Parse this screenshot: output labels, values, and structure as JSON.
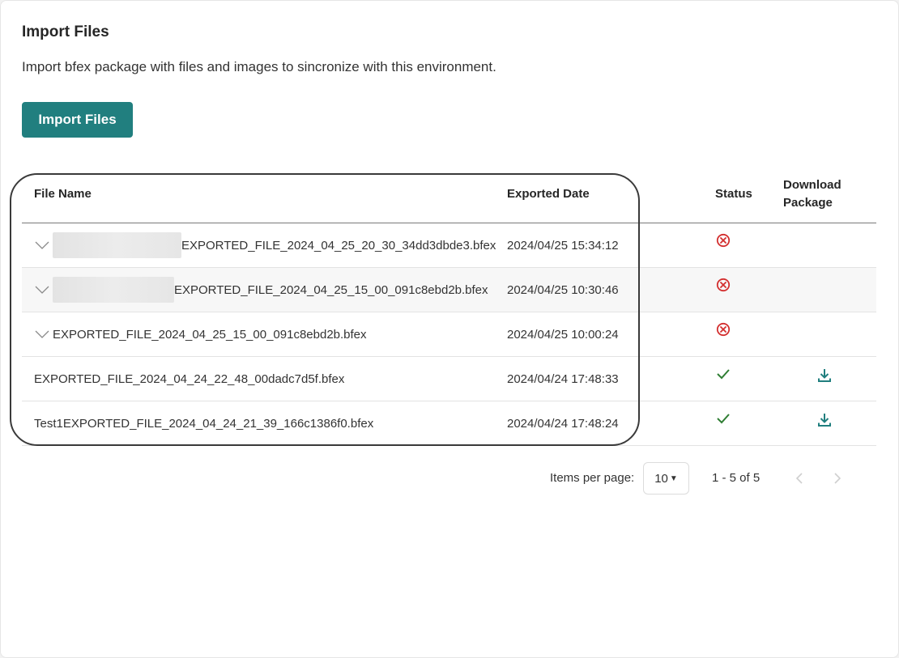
{
  "header": {
    "title": "Import Files",
    "description": "Import bfex package with files and images to sincronize with this environment.",
    "import_button": "Import Files"
  },
  "table": {
    "columns": {
      "file_name": "File Name",
      "exported_date": "Exported Date",
      "status": "Status",
      "download_line1": "Download",
      "download_line2": "Package"
    },
    "rows": [
      {
        "file_name": "EXPORTED_FILE_2024_04_25_20_30_34dd3dbde3.bfex",
        "exported_date": "2024/04/25 15:34:12",
        "status": "error",
        "expandable": true,
        "redacted_prefix": true,
        "downloadable": false
      },
      {
        "file_name": "EXPORTED_FILE_2024_04_25_15_00_091c8ebd2b.bfex",
        "exported_date": "2024/04/25 10:30:46",
        "status": "error",
        "expandable": true,
        "redacted_prefix": true,
        "downloadable": false
      },
      {
        "file_name": "EXPORTED_FILE_2024_04_25_15_00_091c8ebd2b.bfex",
        "exported_date": "2024/04/25 10:00:24",
        "status": "error",
        "expandable": true,
        "redacted_prefix": false,
        "downloadable": false
      },
      {
        "file_name": "EXPORTED_FILE_2024_04_24_22_48_00dadc7d5f.bfex",
        "exported_date": "2024/04/24 17:48:33",
        "status": "success",
        "expandable": false,
        "redacted_prefix": false,
        "downloadable": true
      },
      {
        "file_name": "Test1EXPORTED_FILE_2024_04_24_21_39_166c1386f0.bfex",
        "exported_date": "2024/04/24 17:48:24",
        "status": "success",
        "expandable": false,
        "redacted_prefix": false,
        "downloadable": true
      }
    ]
  },
  "paginator": {
    "items_per_page_label": "Items per page:",
    "page_size": "10",
    "range_label": "1 - 5 of 5"
  },
  "colors": {
    "primary": "#217f7f",
    "error": "#d32f2f",
    "success": "#2e7d32",
    "download": "#217f7f"
  },
  "icons": {
    "expand": "chevron-down-icon",
    "error": "circle-x-icon",
    "success": "check-icon",
    "download": "download-icon",
    "prev": "chevron-left-icon",
    "next": "chevron-right-icon",
    "page_size_caret": "caret-down-icon"
  }
}
